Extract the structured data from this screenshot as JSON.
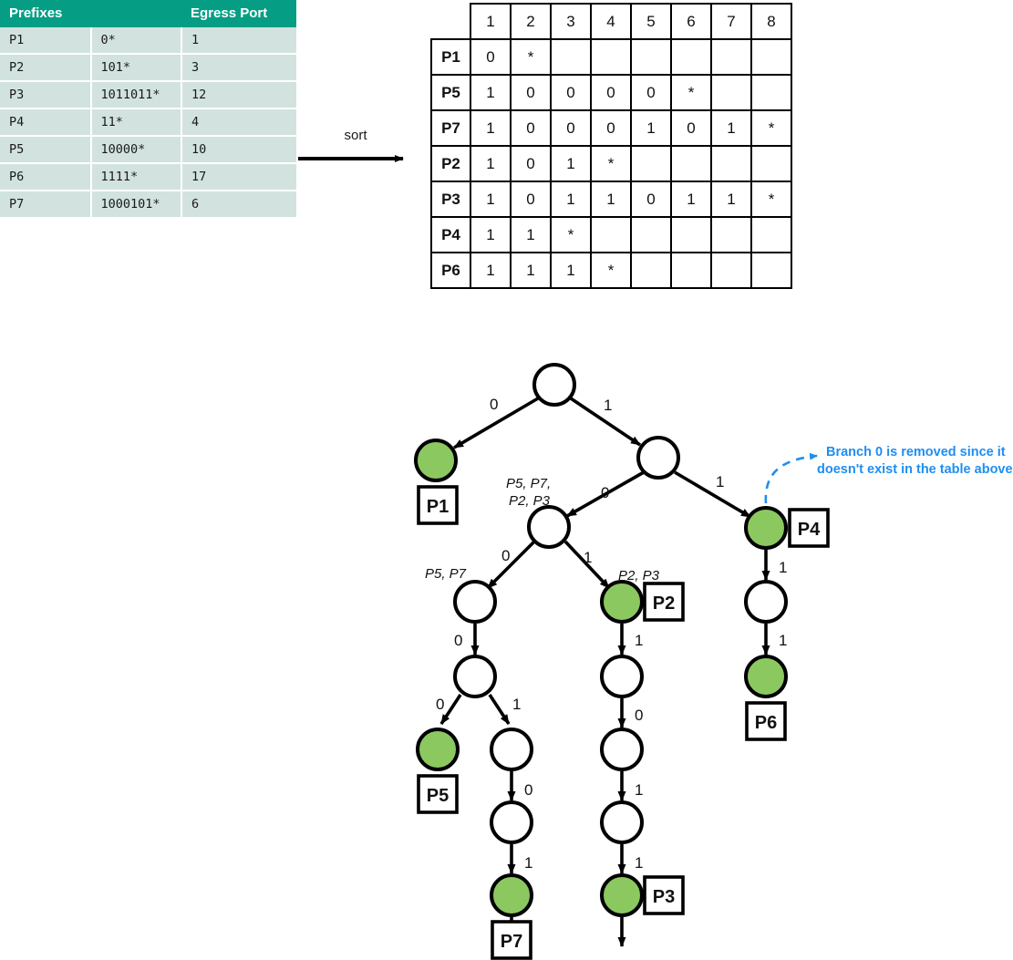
{
  "prefix_table": {
    "headers": [
      "Prefixes",
      "Egress Port"
    ],
    "header_prefixes": "Prefixes",
    "header_egress": "Egress Port",
    "rows": [
      {
        "id": "P1",
        "prefix": "0*",
        "port": "1"
      },
      {
        "id": "P2",
        "prefix": "101*",
        "port": "3"
      },
      {
        "id": "P3",
        "prefix": "1011011*",
        "port": "12"
      },
      {
        "id": "P4",
        "prefix": "11*",
        "port": "4"
      },
      {
        "id": "P5",
        "prefix": "10000*",
        "port": "10"
      },
      {
        "id": "P6",
        "prefix": "1111*",
        "port": "17"
      },
      {
        "id": "P7",
        "prefix": "1000101*",
        "port": "6"
      }
    ]
  },
  "sort_arrow": {
    "label": "sort"
  },
  "matrix": {
    "col_headers": [
      "1",
      "2",
      "3",
      "4",
      "5",
      "6",
      "7",
      "8"
    ],
    "rows": [
      {
        "id": "P1",
        "cells": [
          "0",
          "*",
          "",
          "",
          "",
          "",
          "",
          ""
        ]
      },
      {
        "id": "P5",
        "cells": [
          "1",
          "0",
          "0",
          "0",
          "0",
          "*",
          "",
          ""
        ]
      },
      {
        "id": "P7",
        "cells": [
          "1",
          "0",
          "0",
          "0",
          "1",
          "0",
          "1",
          "*"
        ]
      },
      {
        "id": "P2",
        "cells": [
          "1",
          "0",
          "1",
          "*",
          "",
          "",
          "",
          ""
        ]
      },
      {
        "id": "P3",
        "cells": [
          "1",
          "0",
          "1",
          "1",
          "0",
          "1",
          "1",
          "*"
        ]
      },
      {
        "id": "P4",
        "cells": [
          "1",
          "1",
          "*",
          "",
          "",
          "",
          "",
          ""
        ]
      },
      {
        "id": "P6",
        "cells": [
          "1",
          "1",
          "1",
          "*",
          "",
          "",
          "",
          ""
        ]
      }
    ]
  },
  "tree": {
    "edge_labels": {
      "root_left": "0",
      "root_right": "1",
      "n1_left": "0",
      "n1_right": "1",
      "n2_left": "0",
      "n2_right": "1",
      "n3_down": "0",
      "n4_left": "0",
      "n4_right": "1",
      "n5_down": "0",
      "n6_down": "1",
      "p2_down": "1",
      "n7_down": "0",
      "n8_down": "1",
      "p4_down": "1",
      "n9_down": "1"
    },
    "prefix_notes": {
      "note_mid": "P5, P7,",
      "note_mid2": "P2, P3",
      "note_left": "P5, P7",
      "note_right": "P2, P3"
    },
    "leaf_labels": {
      "p1": "P1",
      "p2": "P2",
      "p3": "P3",
      "p4": "P4",
      "p5": "P5",
      "p6": "P6",
      "p7": "P7"
    }
  },
  "callout": {
    "line1": "Branch 0 is removed since it",
    "line2": "doesn't exist in the table above",
    "color": "#1f8ef1"
  },
  "colors": {
    "table_header": "#059e84",
    "table_row": "#d2e3df",
    "node_green": "#8cc860",
    "node_stroke": "#000000",
    "callout_blue": "#1f8ef1"
  }
}
